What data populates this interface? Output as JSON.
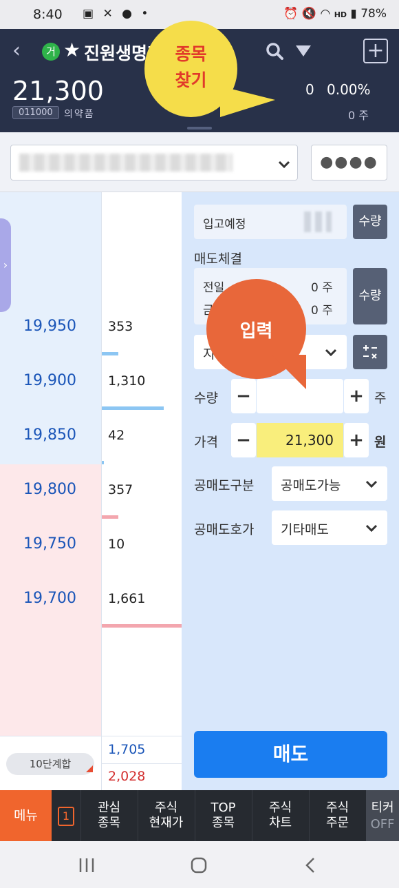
{
  "status_bar": {
    "time": "8:40",
    "battery": "78%",
    "hd": "HD"
  },
  "header": {
    "badge": "거",
    "stock_name": "진원생명과학",
    "price": "21,300",
    "code": "011000",
    "sector": "의약품",
    "change": "0",
    "change_pct": "0.00%",
    "volume": "0 주"
  },
  "callouts": {
    "find_stock": [
      "종목",
      "찾기"
    ],
    "input": "입력"
  },
  "account": {
    "password_mask": "●●●●"
  },
  "orderbook": {
    "rows": [
      {
        "price": "",
        "qty": "",
        "side": "sell",
        "bar": 0
      },
      {
        "price": "",
        "qty": "",
        "side": "sell",
        "bar": 0
      },
      {
        "price": "19,950",
        "qty": "353",
        "side": "sell",
        "bar": 0.21
      },
      {
        "price": "19,900",
        "qty": "1,310",
        "side": "sell",
        "bar": 0.78
      },
      {
        "price": "19,850",
        "qty": "42",
        "side": "sell",
        "bar": 0.03
      },
      {
        "price": "19,800",
        "qty": "357",
        "side": "buy",
        "bar": 0.21
      },
      {
        "price": "19,750",
        "qty": "10",
        "side": "buy",
        "bar": 0
      },
      {
        "price": "19,700",
        "qty": "1,661",
        "side": "buy",
        "bar": 1.0
      },
      {
        "price": "",
        "qty": "",
        "side": "buy",
        "bar": 0
      },
      {
        "price": "",
        "qty": "",
        "side": "buy",
        "bar": 0
      }
    ],
    "summary_label": "10단계합",
    "sell_total": "1,705",
    "buy_total": "2,028"
  },
  "order_panel": {
    "incoming_label": "입고예정",
    "qty_button": "수량",
    "executed_label": "매도체결",
    "prev_day_label": "전일",
    "today_label": "금일",
    "prev_day_value": "0 주",
    "today_value": "0 주",
    "order_type_label": "지정가",
    "quantity_label": "수량",
    "quantity_unit": "주",
    "price_label": "가격",
    "price_value": "21,300",
    "price_unit": "원",
    "short_sell_type_label": "공매도구분",
    "short_sell_type_value": "공매도가능",
    "short_sell_quote_label": "공매도호가",
    "short_sell_quote_value": "기타매도",
    "sell_button": "매도"
  },
  "bottom_menu": {
    "menu": "메뉴",
    "count": "1",
    "items": [
      [
        "관심",
        "종목"
      ],
      [
        "주식",
        "현재가"
      ],
      [
        "TOP",
        "종목"
      ],
      [
        "주식",
        "차트"
      ],
      [
        "주식",
        "주문"
      ]
    ],
    "ticker": [
      "티커",
      "OFF"
    ]
  }
}
